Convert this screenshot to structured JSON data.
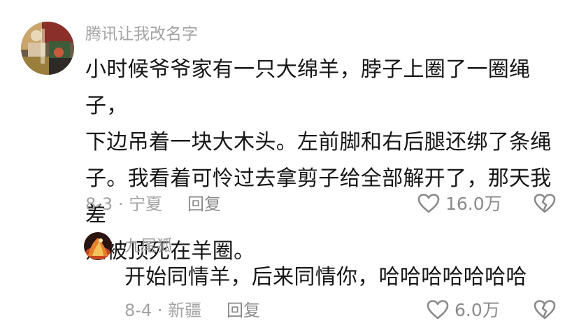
{
  "comment": {
    "username": "腾讯让我改名字",
    "text_lines": [
      "小时候爷爷家有一只大绵羊，脖子上圈了一圈绳子，",
      "下边吊着一块大木头。左前脚和右后腿还绑了条绳",
      "子。我看着可怜过去拿剪子给全部解开了，那天我差",
      "点被顶死在羊圈。"
    ],
    "meta": "8-3 · 宁夏",
    "reply_label": "回复",
    "like_count": "16.0万"
  },
  "reply": {
    "username": "九尾狐",
    "text": "开始同情羊，后来同情你，哈哈哈哈哈哈哈",
    "meta": "8-4 · 新疆",
    "reply_label": "回复",
    "like_count": "6.0万"
  },
  "icons": {
    "like": "heart-outline-icon",
    "dislike": "broken-heart-icon"
  }
}
